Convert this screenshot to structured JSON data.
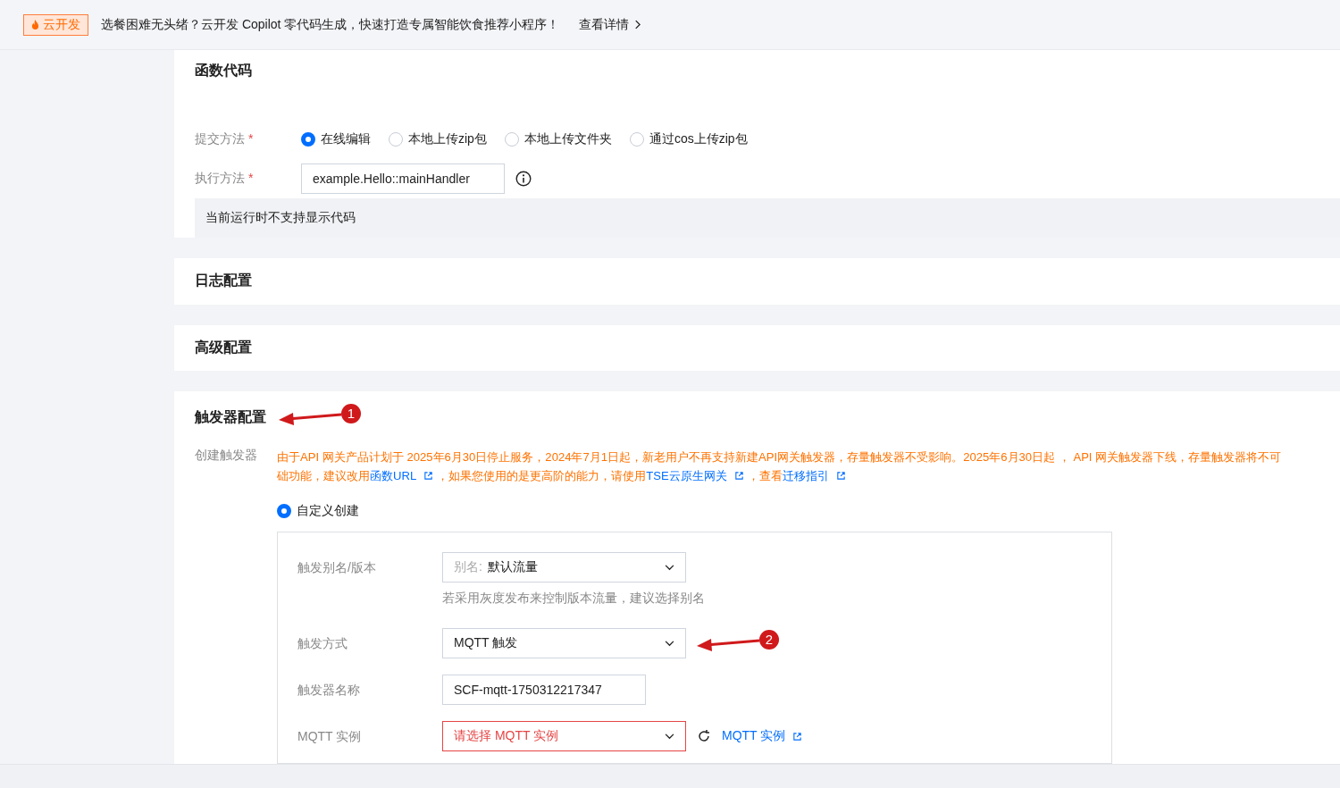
{
  "banner": {
    "badge": "云开发",
    "message": "选餐困难无头绪？云开发 Copilot 零代码生成，快速打造专属智能饮食推荐小程序！",
    "link": "查看详情"
  },
  "sections": [
    {
      "kind": "code",
      "title": "函数代码",
      "submit_label": "提交方法",
      "required_mark": "*",
      "submit_options": [
        {
          "label": "在线编辑",
          "selected": true
        },
        {
          "label": "本地上传zip包",
          "selected": false
        },
        {
          "label": "本地上传文件夹",
          "selected": false
        },
        {
          "label": "通过cos上传zip包",
          "selected": false
        }
      ],
      "handler_label": "执行方法",
      "handler_value": "example.Hello::mainHandler",
      "notice": "当前运行时不支持显示代码"
    },
    {
      "kind": "collapsed",
      "title": "日志配置"
    },
    {
      "kind": "collapsed",
      "title": "高级配置"
    },
    {
      "kind": "trigger",
      "title": "触发器配置",
      "annotation": "1",
      "create_label": "创建触发器",
      "notice_lines": [
        [
          {
            "kind": "text",
            "text": "由于API 网关产品计划于 2025年6月30日停止服务，2024年7月1日起，新老用户不再支持新建API网关触发器，存量触发器不受影响。2025年6月30日起 ， API 网关触发器下线，存量触发器将不可"
          }
        ],
        [
          {
            "kind": "text",
            "text": "础功能，建议改用"
          },
          {
            "kind": "link",
            "text": "函数URL"
          },
          {
            "kind": "text",
            "text": "，如果您使用的是更高阶的能力，请使用"
          },
          {
            "kind": "link",
            "text": "TSE云原生网关"
          },
          {
            "kind": "text",
            "text": "，查看"
          },
          {
            "kind": "link",
            "text": "迁移指引"
          }
        ]
      ],
      "create_options": [
        {
          "label": "自定义创建",
          "selected": true
        }
      ],
      "fields": [
        {
          "kind": "select",
          "label": "触发别名/版本",
          "prefix": "别名:",
          "value": "默认流量",
          "error": false,
          "hint": "若采用灰度发布来控制版本流量，建议选择别名"
        },
        {
          "kind": "select",
          "label": "触发方式",
          "value": "MQTT 触发",
          "error": false,
          "annotation": "2"
        },
        {
          "kind": "input",
          "label": "触发器名称",
          "value": "SCF-mqtt-1750312217347"
        },
        {
          "kind": "select",
          "label": "MQTT 实例",
          "placeholder": "请选择 MQTT 实例",
          "error": true,
          "link": "MQTT 实例"
        }
      ]
    }
  ]
}
